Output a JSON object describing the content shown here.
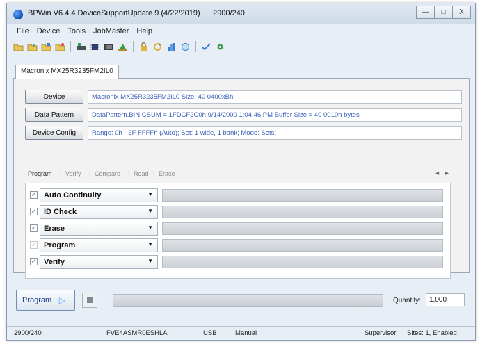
{
  "window": {
    "title": "BPWin  V6.4.4 DeviceSupportUpdate.9 (4/22/2019)",
    "counter": "2900/240",
    "minimize_glyph": "—",
    "maximize_glyph": "□",
    "close_glyph": "X"
  },
  "menu": {
    "items": [
      "File",
      "Device",
      "Tools",
      "JobMaster",
      "Help"
    ]
  },
  "toolbar": {
    "icons": [
      "open-icon",
      "load-icon",
      "save-icon",
      "save-as-icon",
      "device-icon",
      "chip-icon",
      "keypad-icon",
      "import-icon",
      "lock-icon",
      "refresh-icon",
      "chart-icon",
      "info-icon",
      "check-icon",
      "gear-icon"
    ]
  },
  "device_tab": {
    "label": "Macronix MX25R3235FM2IL0"
  },
  "info": {
    "device_button": "Device",
    "device_text": "Macronix MX25R3235FM2IL0    Size: 40 0400xBh",
    "pattern_button": "Data Pattern",
    "pattern_text": "DataPattern.BIN    CSUM = 1FDCF2C0h    9/14/2000 1:04:46 PM    Buffer Size = 40 0010h bytes",
    "config_button": "Device Config",
    "config_text": "Range:  0h - 3F FFFFh (Auto);  Set: 1 wide, 1 bank;  Mode:  Sets;"
  },
  "op_tabs": {
    "items": [
      "Program",
      "Verify",
      "Compare",
      "Read",
      "Erase"
    ],
    "separator": "|",
    "nav": "◂ ▸"
  },
  "operations": {
    "check_glyph": "✓",
    "arrow_glyph": "▼",
    "rows": [
      {
        "label": "Auto Continuity"
      },
      {
        "label": "ID Check"
      },
      {
        "label": "Erase"
      },
      {
        "label": "Program"
      },
      {
        "label": "Verify"
      }
    ]
  },
  "controls": {
    "program_button": "Program",
    "play_glyph": "▷",
    "quantity_label": "Quantity:",
    "quantity_value": "1,000"
  },
  "status": {
    "counter": "2900/240",
    "serial": "FVE4ASMR0ESHLA",
    "port": "USB",
    "mode": "Manual",
    "user": "Supervisor",
    "sites": "Sites: 1, Enabled"
  },
  "colors": {
    "link_text": "#3a5fb8",
    "window_bg": "#e8eef5"
  }
}
